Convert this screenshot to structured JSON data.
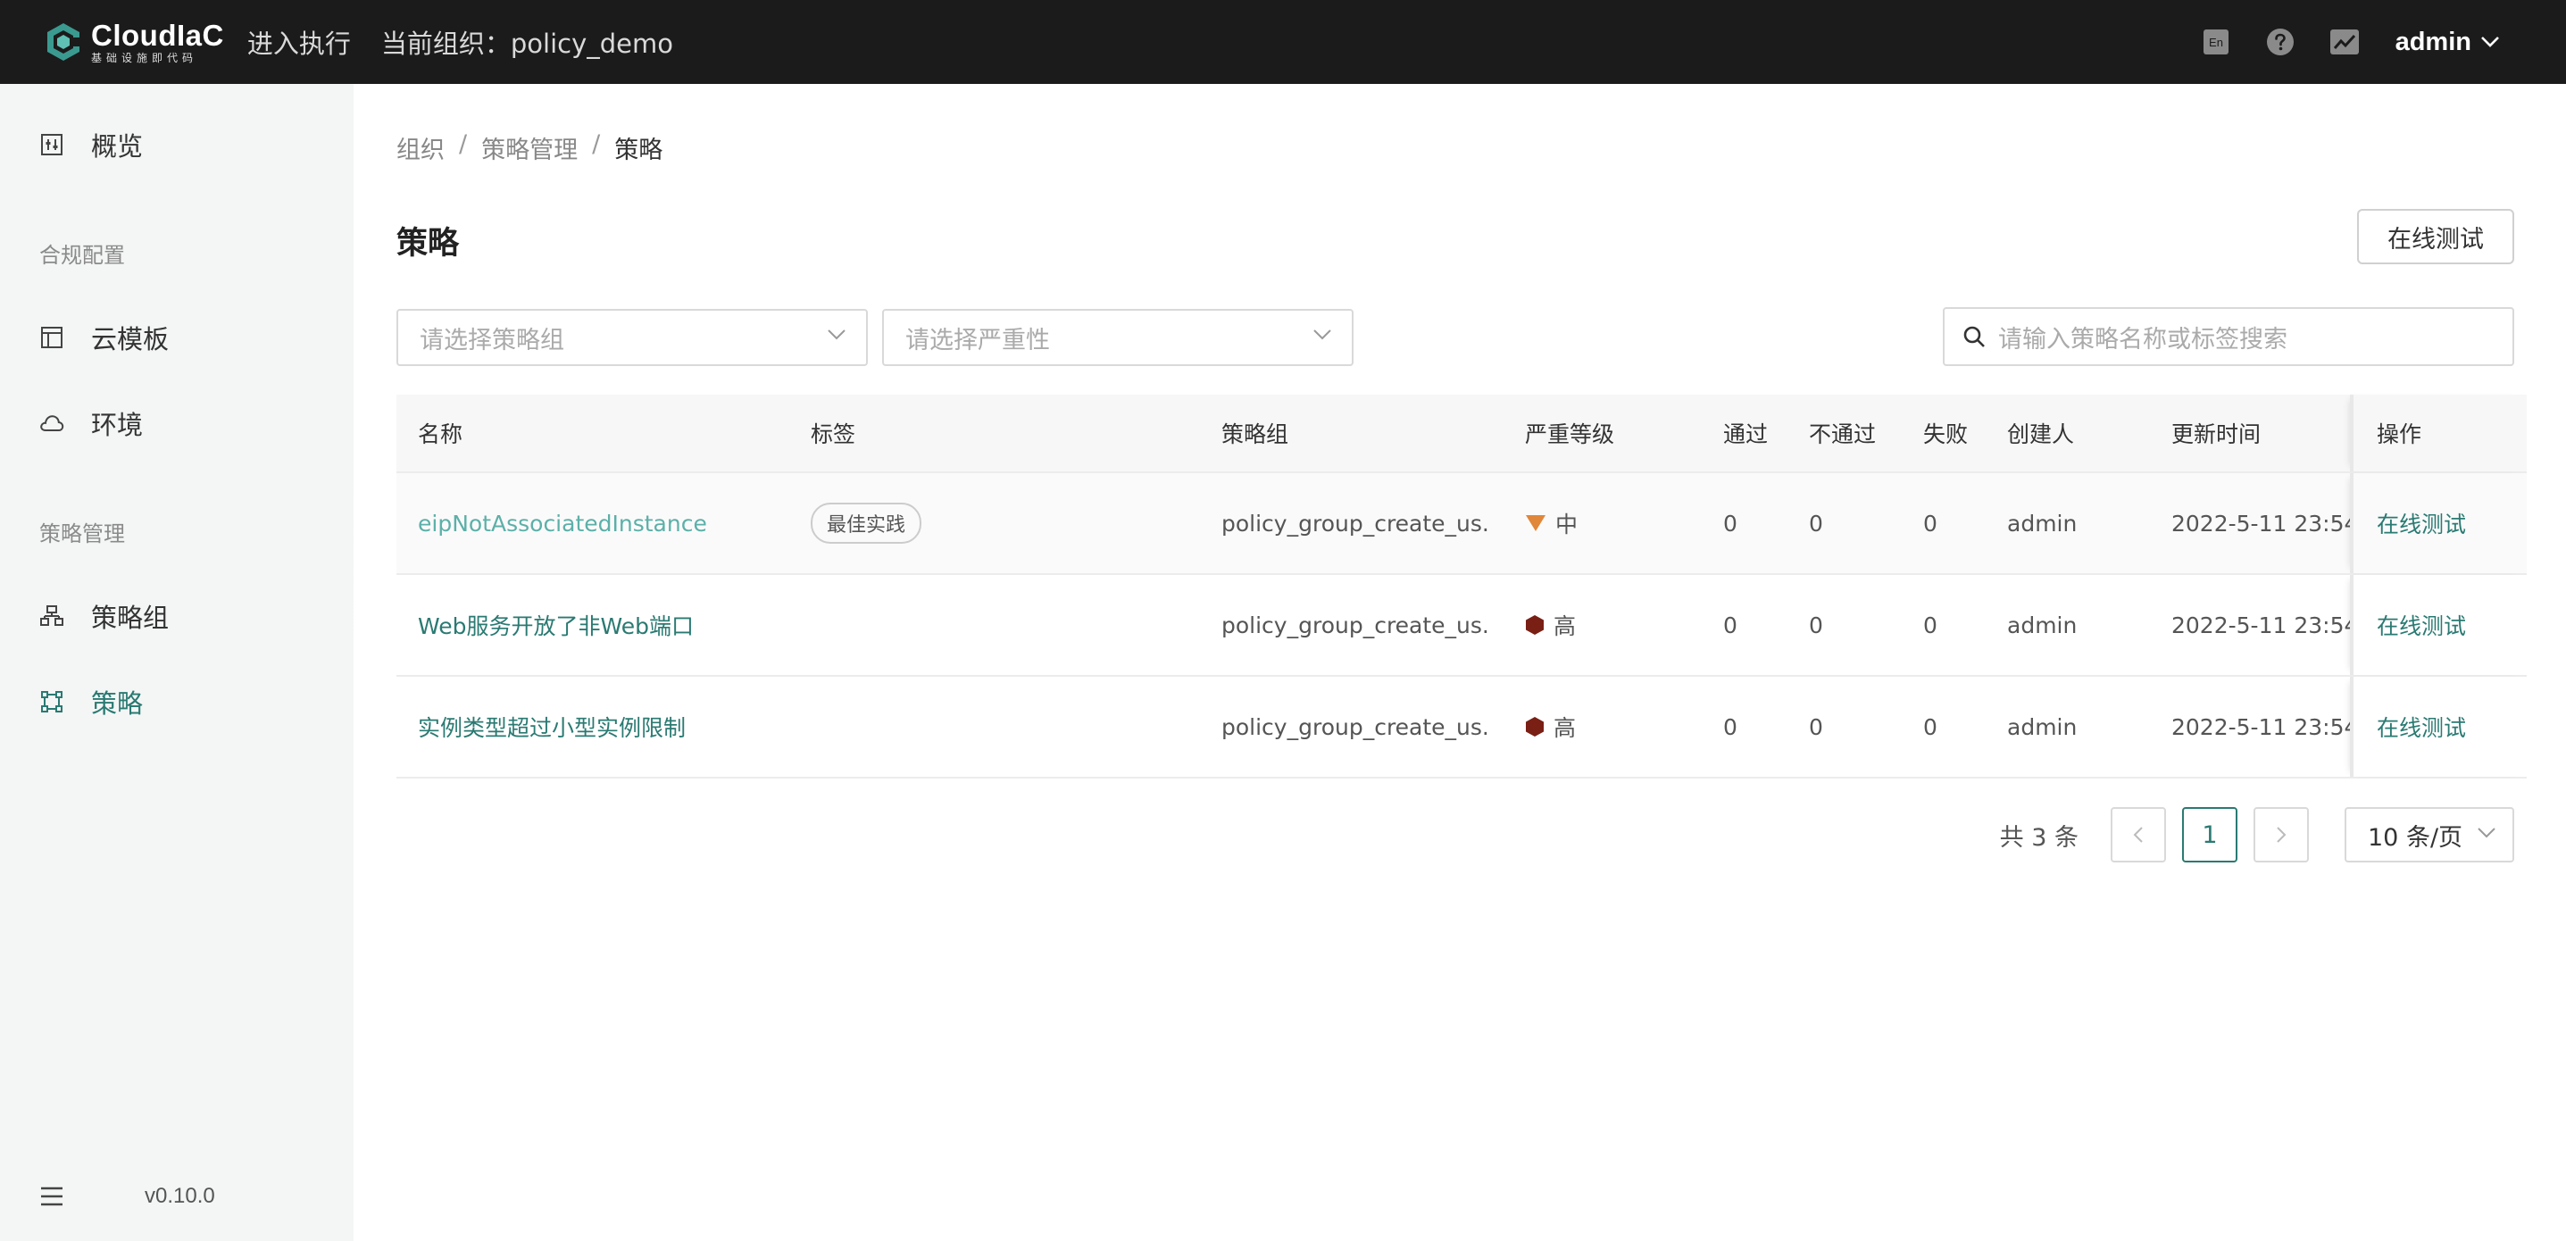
{
  "header": {
    "logo_name": "CloudIaC",
    "logo_sub": "基础设施即代码",
    "enter_exec": "进入执行",
    "current_org_label": "当前组织：",
    "current_org": "policy_demo",
    "lang_icon_text": "En",
    "user": "admin"
  },
  "sidebar": {
    "overview": "概览",
    "group_compliance": "合规配置",
    "cloud_template": "云模板",
    "environment": "环境",
    "group_policy": "策略管理",
    "policy_group": "策略组",
    "policy": "策略",
    "version": "v0.10.0"
  },
  "breadcrumb": [
    "组织",
    "策略管理",
    "策略"
  ],
  "page": {
    "title": "策略",
    "online_test_button": "在线测试"
  },
  "filters": {
    "policy_group_placeholder": "请选择策略组",
    "severity_placeholder": "请选择严重性",
    "search_placeholder": "请输入策略名称或标签搜索"
  },
  "table": {
    "columns": [
      "名称",
      "标签",
      "策略组",
      "严重等级",
      "通过",
      "不通过",
      "失败",
      "创建人",
      "更新时间",
      "操作"
    ],
    "rows": [
      {
        "name": "eipNotAssociatedInstance",
        "tag": "最佳实践",
        "group": "policy_group_create_us...",
        "severity": "中",
        "pass": "0",
        "fail": "0",
        "error": "0",
        "creator": "admin",
        "updated": "2022-5-11 23:54",
        "action": "在线测试"
      },
      {
        "name": "Web服务开放了非Web端口",
        "tag": "",
        "group": "policy_group_create_us...",
        "severity": "高",
        "pass": "0",
        "fail": "0",
        "error": "0",
        "creator": "admin",
        "updated": "2022-5-11 23:54",
        "action": "在线测试"
      },
      {
        "name": "实例类型超过小型实例限制",
        "tag": "",
        "group": "policy_group_create_us...",
        "severity": "高",
        "pass": "0",
        "fail": "0",
        "error": "0",
        "creator": "admin",
        "updated": "2022-5-11 23:54",
        "action": "在线测试"
      }
    ]
  },
  "pagination": {
    "total": "共 3 条",
    "current_page": "1",
    "page_size": "10 条/页"
  },
  "colors": {
    "accent": "#2a7a72",
    "severity_medium": "#e0873a",
    "severity_high": "#7a1f14",
    "topbar": "#1b1b1b"
  }
}
